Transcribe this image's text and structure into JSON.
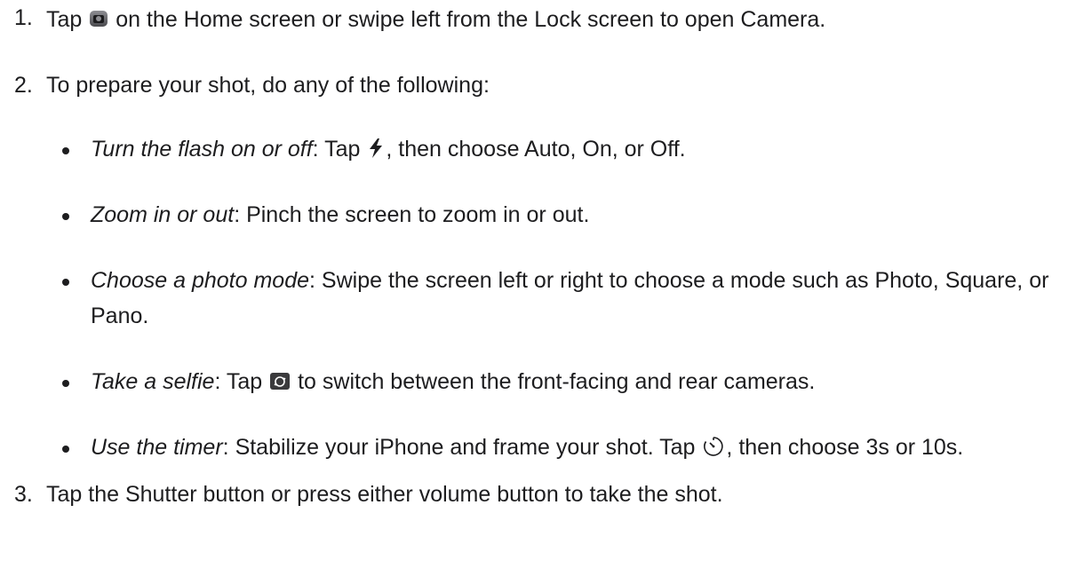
{
  "steps": [
    {
      "num": "1.",
      "before": "Tap",
      "icon": "camera-app-icon",
      "after": "on the Home screen or swipe left from the Lock screen to open Camera."
    },
    {
      "num": "2.",
      "text": "To prepare your shot, do any of the following:",
      "items": [
        {
          "term": "Turn the flash on or off",
          "before": ": Tap",
          "icon": "flash-icon",
          "after": ", then choose Auto, On, or Off."
        },
        {
          "term": "Zoom in or out",
          "text": ": Pinch the screen to zoom in or out."
        },
        {
          "term": "Choose a photo mode",
          "text": ": Swipe the screen left or right to choose a mode such as Photo, Square, or Pano."
        },
        {
          "term": "Take a selfie",
          "before": ": Tap",
          "icon": "switch-camera-icon",
          "after": "to switch between the front-facing and rear cameras."
        },
        {
          "term": "Use the timer",
          "before": ": Stabilize your iPhone and frame your shot. Tap",
          "icon": "timer-icon",
          "after": ", then choose 3s or 10s."
        }
      ]
    },
    {
      "num": "3.",
      "text": "Tap the Shutter button or press either volume button to take the shot."
    }
  ]
}
